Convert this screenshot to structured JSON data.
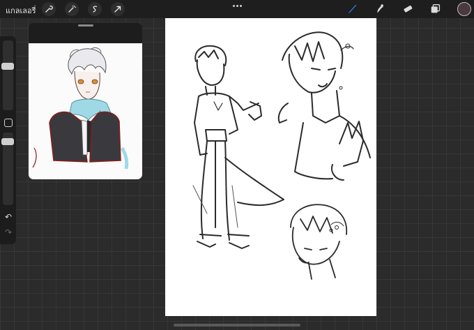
{
  "toolbar": {
    "gallery_label": "แกลเลอรี่",
    "left_tools": [
      "wrench-icon",
      "magic-wand-icon",
      "selection-icon",
      "transform-arrow-icon"
    ],
    "right_tools": [
      "brush-icon",
      "smudge-icon",
      "eraser-icon",
      "layers-icon"
    ],
    "active_tool": "brush-icon",
    "active_color": "#4a3a40",
    "accent_color": "#2f7cf6"
  },
  "sidebar": {
    "controls": [
      "brush-size-slider",
      "modify-button",
      "opacity-slider",
      "undo-icon",
      "redo-icon"
    ]
  },
  "reference": {
    "title": ""
  },
  "canvas": {
    "background": "#ffffff"
  }
}
